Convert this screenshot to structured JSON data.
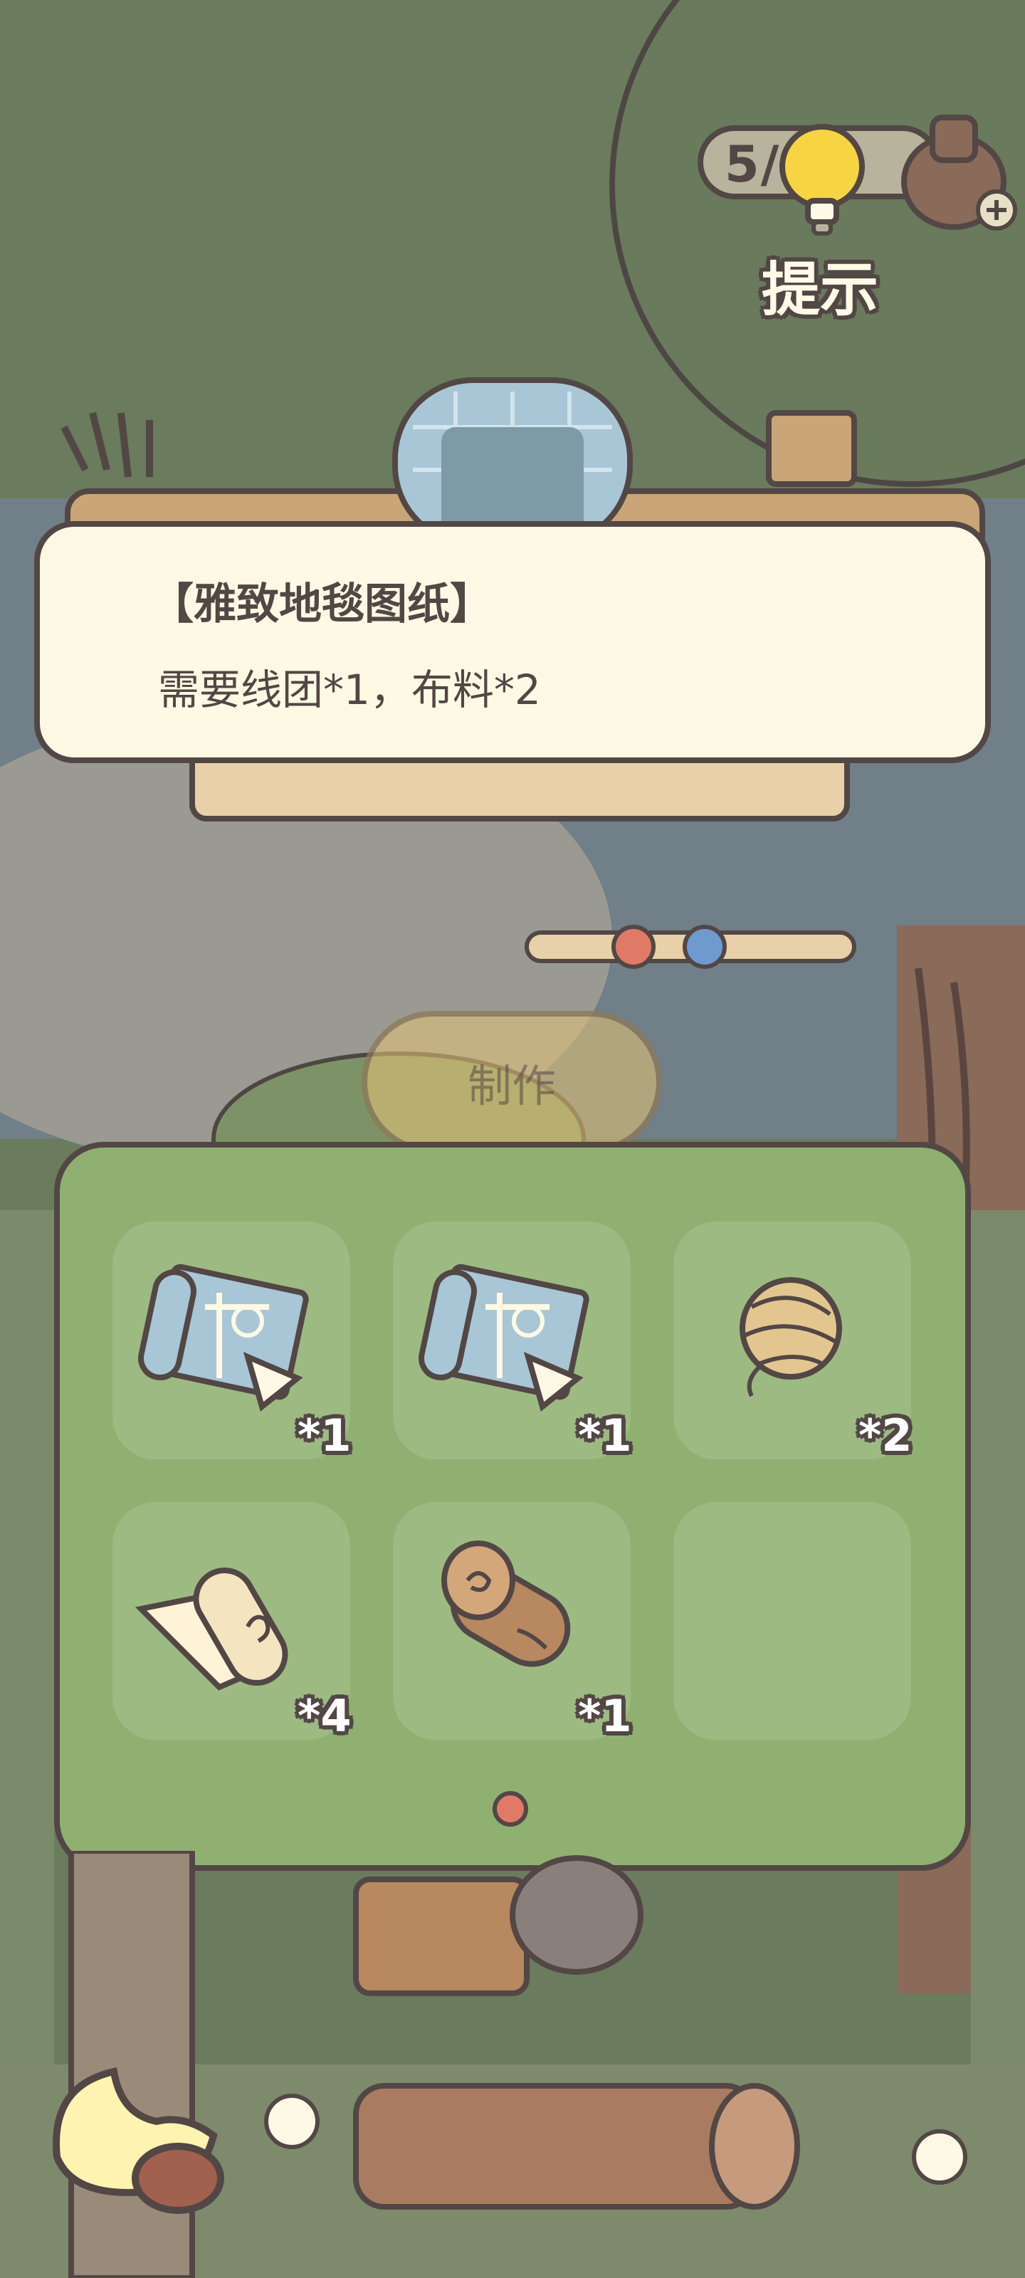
{
  "hint": {
    "count": "5/14",
    "label": "提示"
  },
  "recipe": {
    "title": "【雅致地毯图纸】",
    "requirement": "需要线团*1，布料*2"
  },
  "make_button": {
    "label": "制作"
  },
  "inventory": {
    "slots": [
      {
        "item": "blueprint-icon",
        "quantity": "*1"
      },
      {
        "item": "blueprint-icon",
        "quantity": "*1"
      },
      {
        "item": "yarn-ball-icon",
        "quantity": "*2"
      },
      {
        "item": "cloth-roll-icon",
        "quantity": "*4"
      },
      {
        "item": "wood-log-icon",
        "quantity": "*1"
      },
      {
        "item": "empty-slot",
        "quantity": ""
      }
    ],
    "page_indicator": {
      "current": 1,
      "total": 1
    }
  },
  "colors": {
    "outline": "#524745",
    "card_background": "#fef9e4",
    "panel_green": "#8fb071",
    "button_gold": "#e8c476",
    "page_dot": "#e07a66"
  }
}
